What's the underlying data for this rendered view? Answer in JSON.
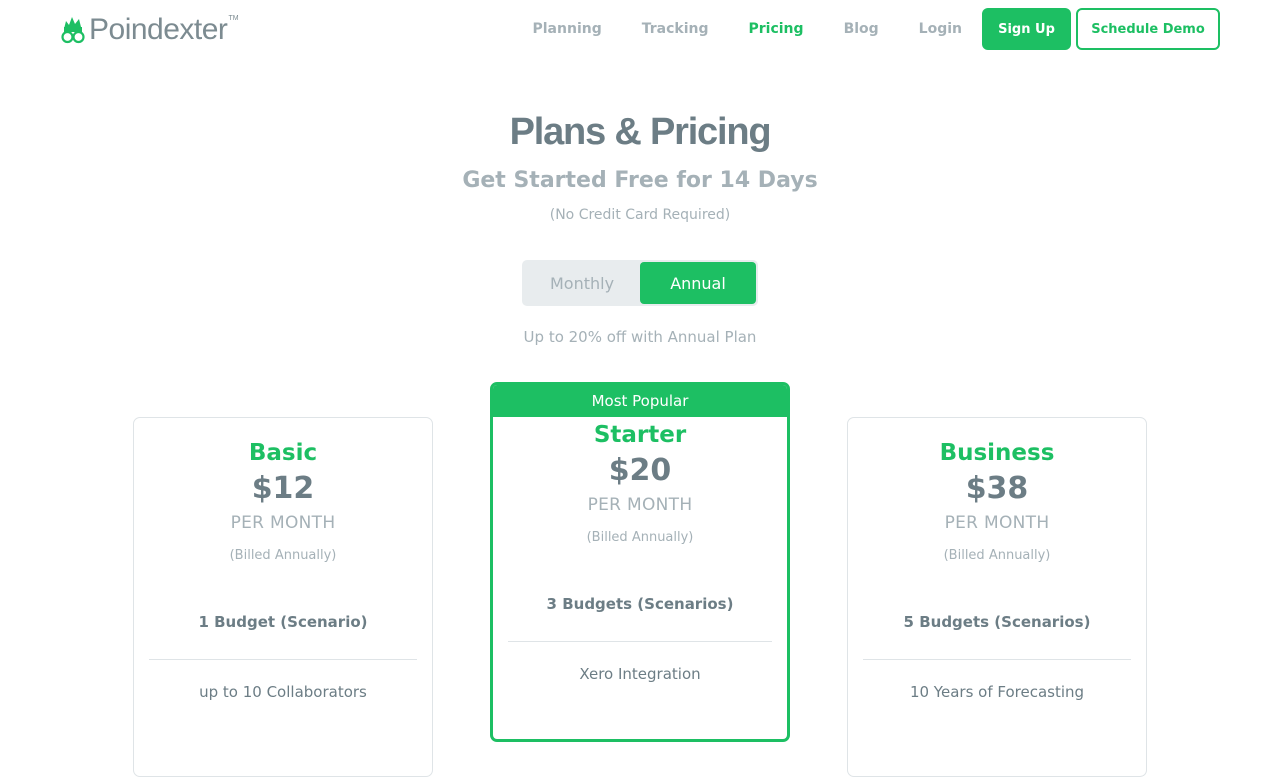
{
  "brand": {
    "name": "Poindexter",
    "trademark": "TM",
    "logo_icon": "poindexter-nerd-glasses-icon",
    "accent_color": "#1dbf63"
  },
  "nav": {
    "links": [
      "Planning",
      "Tracking",
      "Pricing",
      "Blog",
      "Login"
    ],
    "active": "Pricing",
    "signup_label": "Sign Up",
    "demo_label": "Schedule Demo"
  },
  "hero": {
    "title": "Plans & Pricing",
    "subtitle": "Get Started Free for 14 Days",
    "note": "(No Credit Card Required)"
  },
  "billing_toggle": {
    "options": [
      "Monthly",
      "Annual"
    ],
    "selected": "Annual",
    "discount_note": "Up to 20% off with Annual Plan"
  },
  "plans": [
    {
      "name": "Basic",
      "price": "$12",
      "period": "PER MONTH",
      "billing": "(Billed Annually)",
      "primary_feature": "1 Budget (Scenario)",
      "feature": "up to 10 Collaborators"
    },
    {
      "name": "Starter",
      "badge": "Most Popular",
      "price": "$20",
      "period": "PER MONTH",
      "billing": "(Billed Annually)",
      "primary_feature": "3 Budgets (Scenarios)",
      "feature": "Xero Integration"
    },
    {
      "name": "Business",
      "price": "$38",
      "period": "PER MONTH",
      "billing": "(Billed Annually)",
      "primary_feature": "5 Budgets (Scenarios)",
      "feature": "10 Years of Forecasting"
    }
  ]
}
